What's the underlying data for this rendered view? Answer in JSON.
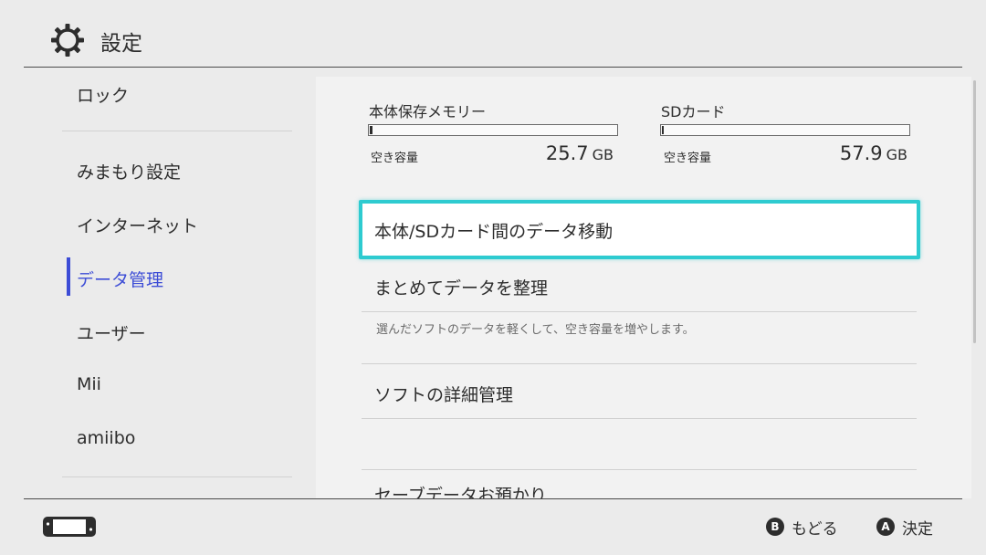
{
  "header": {
    "icon": "gear-icon",
    "title": "設定"
  },
  "sidebar": {
    "items": [
      {
        "label": "ロック",
        "active": false
      },
      {
        "label": "みまもり設定",
        "active": false
      },
      {
        "label": "インターネット",
        "active": false
      },
      {
        "label": "データ管理",
        "active": true
      },
      {
        "label": "ユーザー",
        "active": false
      },
      {
        "label": "Mii",
        "active": false
      },
      {
        "label": "amiibo",
        "active": false
      }
    ]
  },
  "storage": {
    "system": {
      "label": "本体保存メモリー",
      "free_label": "空き容量",
      "free_value": "25.7",
      "free_unit": "GB",
      "used_fraction": 0.01
    },
    "sd": {
      "label": "SDカード",
      "free_label": "空き容量",
      "free_value": "57.9",
      "free_unit": "GB",
      "used_fraction": 0.005
    }
  },
  "menu": {
    "items": [
      {
        "label": "本体/SDカード間のデータ移動",
        "selected": true
      },
      {
        "label": "まとめてデータを整理",
        "description": "選んだソフトのデータを軽くして、空き容量を増やします。"
      },
      {
        "label": "ソフトの詳細管理"
      },
      {
        "label": "セーブデータお預かり"
      }
    ]
  },
  "footer": {
    "console_icon": "console-handheld-icon",
    "back": {
      "button": "B",
      "label": "もどる"
    },
    "confirm": {
      "button": "A",
      "label": "決定"
    }
  },
  "colors": {
    "accent": "#3c4cd6",
    "selection": "#2ecbd0",
    "background": "#ebebeb"
  }
}
